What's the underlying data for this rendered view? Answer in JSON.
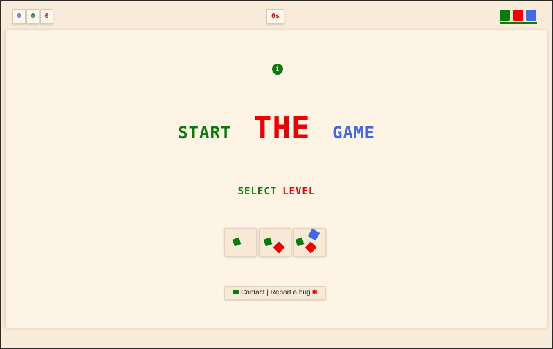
{
  "header": {
    "scores": [
      {
        "value": "0",
        "color": "#4169e1"
      },
      {
        "value": "0",
        "color": "#0a7a0a"
      },
      {
        "value": "0",
        "color": "#e00000"
      }
    ],
    "timer": "0s",
    "theme_colors": [
      "#0a7a0a",
      "#e00000",
      "#4169e1"
    ]
  },
  "title": {
    "word1": "START",
    "word2": "THE",
    "word3": "GAME"
  },
  "subtitle": {
    "word1": "SELECT",
    "word2": "LEVEL"
  },
  "levels": [
    {
      "level": 1,
      "squares": [
        "green"
      ]
    },
    {
      "level": 2,
      "squares": [
        "green",
        "red"
      ]
    },
    {
      "level": 3,
      "squares": [
        "green",
        "red",
        "blue"
      ]
    }
  ],
  "footer": {
    "contact_label": "Contact",
    "separator": "|",
    "bug_label": "Report a bug"
  },
  "colors": {
    "green": "#0a7a0a",
    "red": "#e00000",
    "blue": "#4169e1",
    "background": "#f9ebd9",
    "board": "#fdf4e5"
  },
  "icons": {
    "info": "info-icon",
    "mail": "envelope-icon",
    "bug": "bug-icon"
  }
}
